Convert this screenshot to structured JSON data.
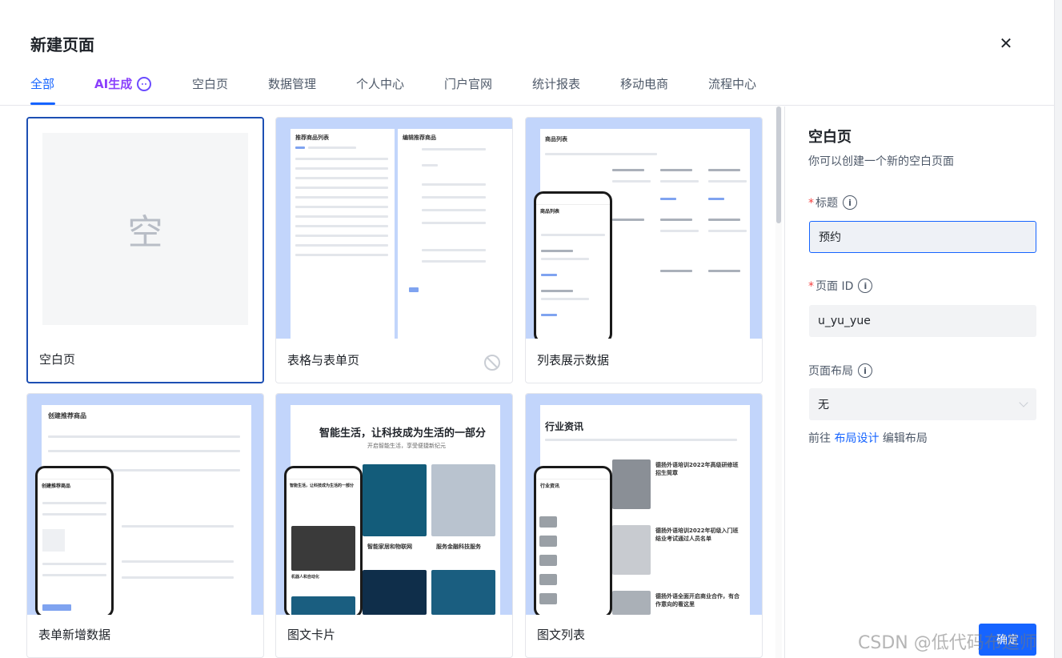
{
  "dialog": {
    "title": "新建页面"
  },
  "tabs": [
    {
      "label": "全部"
    },
    {
      "label": "AI生成"
    },
    {
      "label": "空白页"
    },
    {
      "label": "数据管理"
    },
    {
      "label": "个人中心"
    },
    {
      "label": "门户官网"
    },
    {
      "label": "统计报表"
    },
    {
      "label": "移动电商"
    },
    {
      "label": "流程中心"
    }
  ],
  "templates": [
    {
      "label": "空白页",
      "placeholder_char": "空"
    },
    {
      "label": "表格与表单页",
      "preview_left_title": "推荐商品列表",
      "preview_right_title": "编辑推荐商品"
    },
    {
      "label": "列表展示数据",
      "preview_title": "商品列表",
      "phone_title": "商品列表"
    },
    {
      "label": "表单新增数据",
      "preview_title": "创建推荐商品",
      "phone_title": "创建推荐商品"
    },
    {
      "label": "图文卡片",
      "preview_heading": "智能生活，让科技成为生活的一部分",
      "preview_sub": "开启智能生活，享受便捷新纪元",
      "card_a": "智能家居和物联网",
      "card_b": "服务金融科技服务",
      "phone_heading": "智能生活，让科技成为生活的一部分",
      "phone_card": "机器人和自动化"
    },
    {
      "label": "图文列表",
      "preview_heading": "行业资讯",
      "item_a": "德扬外语培训2022年高级研修班招生简章",
      "item_b": "德扬外语培训2022年初级入门班结业考试通过人员名单",
      "item_c": "德扬外语全面开启商业合作，有合作意向的看这里",
      "phone_title": "行业资讯"
    }
  ],
  "side_panel": {
    "title": "空白页",
    "subtitle": "你可以创建一个新的空白页面",
    "title_label": "标题",
    "title_value": "预约",
    "id_label": "页面 ID",
    "id_value": "u_yu_yue",
    "layout_label": "页面布局",
    "layout_value": "无",
    "goto_prefix": "前往",
    "goto_link": "布局设计",
    "goto_suffix": "编辑布局",
    "confirm_button": "确定"
  },
  "watermark": "CSDN @低代码布道师",
  "colors": {
    "accent": "#1664ff",
    "preview_bg": "#c2d5fb",
    "ai": "#8a3ffc"
  }
}
